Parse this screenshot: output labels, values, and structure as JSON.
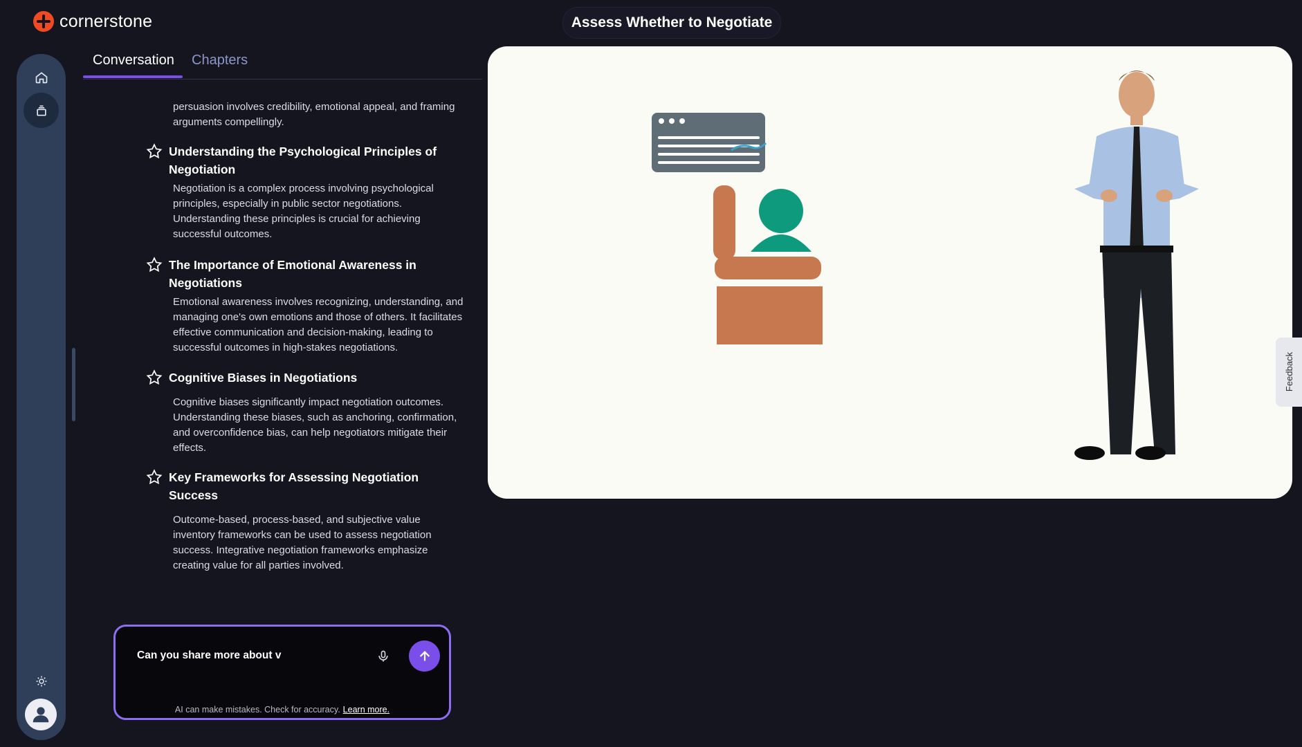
{
  "header": {
    "brand": "cornerstone",
    "lesson_title": "Assess Whether to Negotiate"
  },
  "sidebar": {
    "items": [
      {
        "icon": "home-icon"
      },
      {
        "icon": "layers-icon"
      },
      {
        "icon": "sun-icon"
      },
      {
        "icon": "user-avatar-icon"
      }
    ]
  },
  "tabs": [
    {
      "label": "Conversation",
      "active": true
    },
    {
      "label": "Chapters",
      "active": false
    }
  ],
  "content": {
    "truncated_text": "persuasion involves credibility, emotional appeal, and framing arguments compellingly.",
    "items": [
      {
        "title": "Understanding the Psychological Principles of Negotiation",
        "body": "Negotiation is a complex process involving psychological principles, especially in public sector negotiations. Understanding these principles is crucial for achieving successful outcomes."
      },
      {
        "title": "The Importance of Emotional Awareness in Negotiations",
        "body": "Emotional awareness involves recognizing, understanding, and managing one's own emotions and those of others. It facilitates effective communication and decision-making, leading to successful outcomes in high-stakes negotiations."
      },
      {
        "title": "Cognitive Biases in Negotiations",
        "body": "Cognitive biases significantly impact negotiation outcomes. Understanding these biases, such as anchoring, confirmation, and overconfidence bias, can help negotiators mitigate their effects."
      },
      {
        "title": "Key Frameworks for Assessing Negotiation Success",
        "body": "Outcome-based, process-based, and subjective value inventory frameworks can be used to assess negotiation success. Integrative negotiation frameworks emphasize creating value for all parties involved."
      }
    ]
  },
  "chat": {
    "input_value": "Can you share more about v",
    "disclaimer": "AI can make mistakes. Check for accuracy.",
    "learn_more": "Learn more."
  },
  "feedback": {
    "label": "Feedback"
  },
  "colors": {
    "accent": "#7a4fe9",
    "brand": "#f04a24",
    "background": "#15151f",
    "rail": "#2f3f59"
  }
}
